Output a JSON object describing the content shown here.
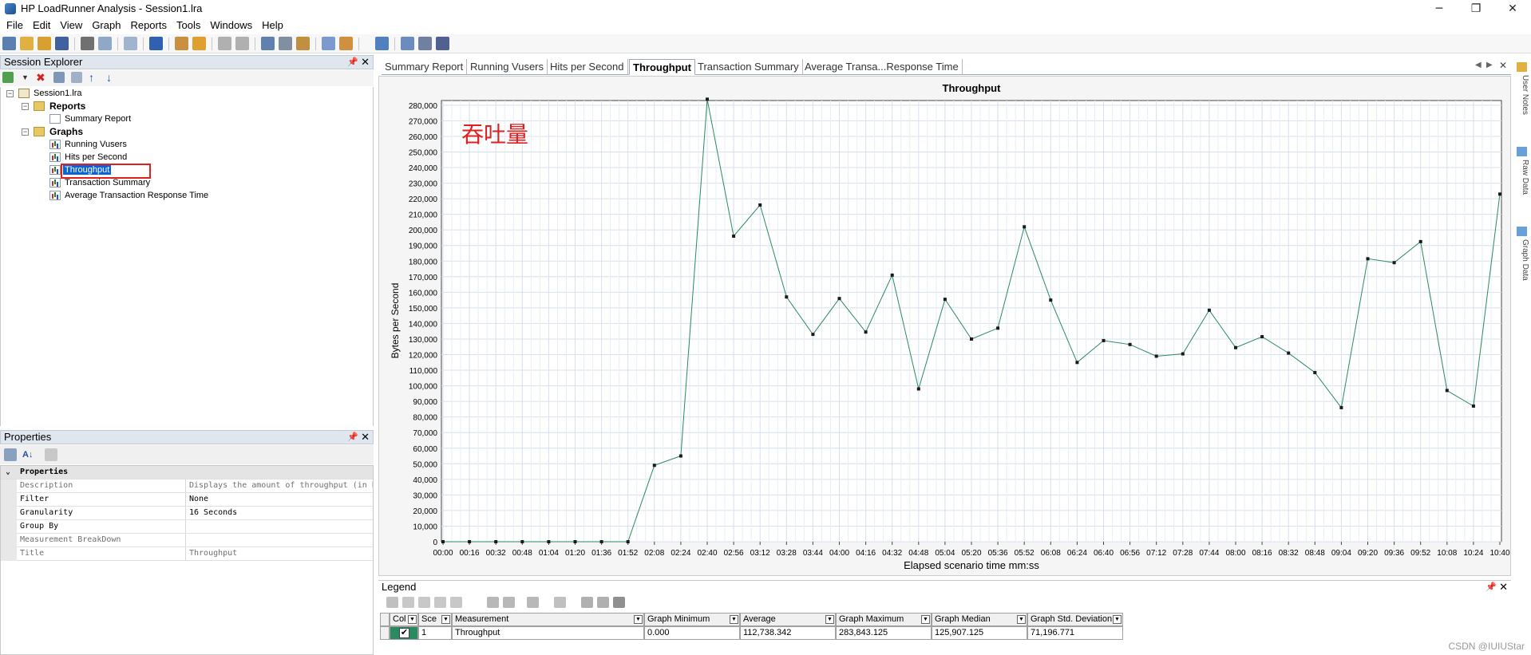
{
  "window": {
    "title": "HP LoadRunner Analysis - Session1.lra",
    "controls": {
      "minimize": "─",
      "restore": "❐",
      "close": "✕"
    }
  },
  "menu": [
    "File",
    "Edit",
    "View",
    "Graph",
    "Reports",
    "Tools",
    "Windows",
    "Help"
  ],
  "session_explorer": {
    "title": "Session Explorer",
    "tree": {
      "session": "Session1.lra",
      "reports_label": "Reports",
      "reports": [
        "Summary Report"
      ],
      "graphs_label": "Graphs",
      "graphs": [
        "Running Vusers",
        "Hits per Second",
        "Throughput",
        "Transaction Summary",
        "Average Transaction Response Time"
      ],
      "selected": "Throughput"
    }
  },
  "properties": {
    "title": "Properties",
    "section": "Properties",
    "rows": [
      {
        "key": "Description",
        "value": "Displays the amount of throughput (in b"
      },
      {
        "key": "Filter",
        "value": "None"
      },
      {
        "key": "Granularity",
        "value": "16 Seconds"
      },
      {
        "key": "Group By",
        "value": ""
      },
      {
        "key": "Measurement BreakDown",
        "value": ""
      },
      {
        "key": "Title",
        "value": "Throughput"
      }
    ]
  },
  "tabs": [
    "Summary Report",
    "Running Vusers",
    "Hits per Second",
    "Throughput",
    "Transaction Summary",
    "Average Transa...Response Time"
  ],
  "active_tab": "Throughput",
  "annotation": "吞吐量",
  "legend": {
    "title": "Legend",
    "headers": [
      "Col",
      "Sce",
      "Measurement",
      "Graph Minimum",
      "Average",
      "Graph Maximum",
      "Graph Median",
      "Graph Std. Deviation"
    ],
    "rows": [
      {
        "checked": true,
        "color": "#2a8a60",
        "sce": "1",
        "measurement": "Throughput",
        "min": "0.000",
        "avg": "112,738.342",
        "max": "283,843.125",
        "median": "125,907.125",
        "std": "71,196.771"
      }
    ]
  },
  "side_tabs": [
    "User Notes",
    "Raw Data",
    "Graph Data"
  ],
  "watermark": "CSDN @IUIUStar",
  "chart_data": {
    "type": "line",
    "title": "Throughput",
    "xlabel": "Elapsed scenario time mm:ss",
    "ylabel": "Bytes per Second",
    "ylim": [
      0,
      283000
    ],
    "grid": true,
    "line_color": "#2a8a60",
    "x": [
      "00:00",
      "00:16",
      "00:32",
      "00:48",
      "01:04",
      "01:20",
      "01:36",
      "01:52",
      "02:08",
      "02:24",
      "02:40",
      "02:56",
      "03:12",
      "03:28",
      "03:44",
      "04:00",
      "04:16",
      "04:32",
      "04:48",
      "05:04",
      "05:20",
      "05:36",
      "05:52",
      "06:08",
      "06:24",
      "06:40",
      "06:56",
      "07:12",
      "07:28",
      "07:44",
      "08:00",
      "08:16",
      "08:32",
      "08:48",
      "09:04",
      "09:20",
      "09:36",
      "09:52",
      "10:08",
      "10:24",
      "10:40"
    ],
    "y_ticks": [
      "0",
      "10,000",
      "20,000",
      "30,000",
      "40,000",
      "50,000",
      "60,000",
      "70,000",
      "80,000",
      "90,000",
      "100,000",
      "110,000",
      "120,000",
      "130,000",
      "140,000",
      "150,000",
      "160,000",
      "170,000",
      "180,000",
      "190,000",
      "200,000",
      "210,000",
      "220,000",
      "230,000",
      "240,000",
      "250,000",
      "260,000",
      "270,000",
      "280,000"
    ],
    "series": [
      {
        "values": [
          0,
          0,
          0,
          0,
          0,
          0,
          0,
          0,
          49000,
          55000,
          283843,
          196000,
          216000,
          157000,
          133000,
          156000,
          134500,
          171000,
          98000,
          155500,
          130000,
          137000,
          202000,
          155000,
          115000,
          129000,
          126500,
          119000,
          120500,
          148500,
          124500,
          131500,
          121000,
          108500,
          86000,
          181500,
          179000,
          192500,
          97000,
          87000,
          223000
        ]
      }
    ]
  }
}
